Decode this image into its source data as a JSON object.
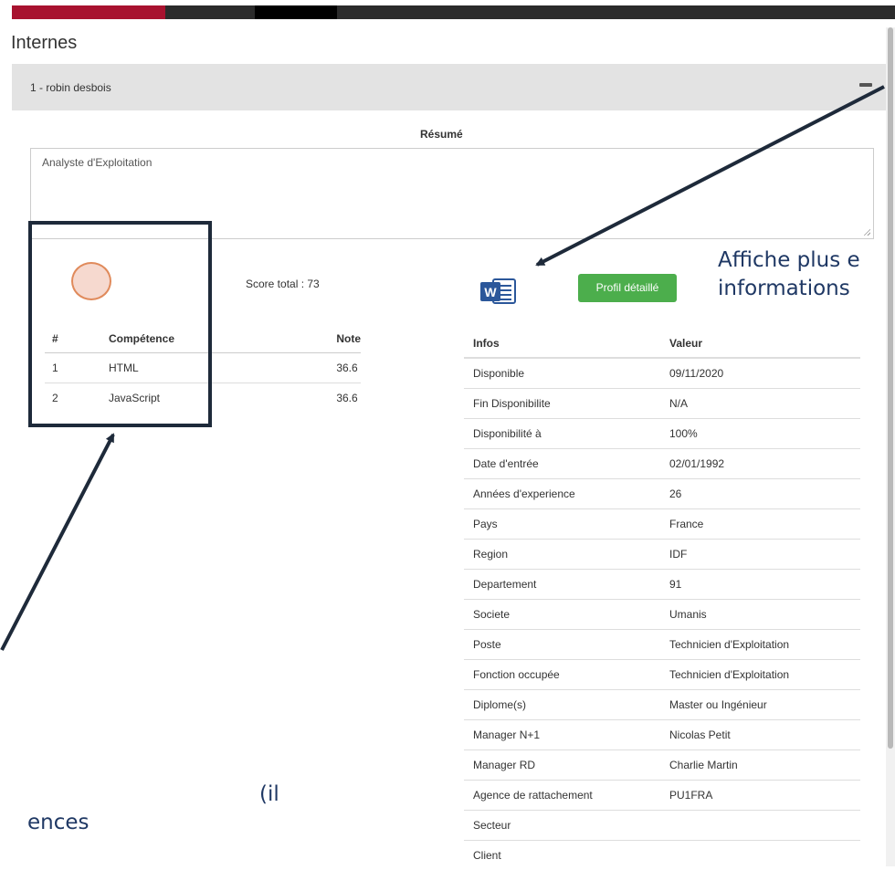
{
  "section": {
    "title": "Internes"
  },
  "panel": {
    "label": "1 - robin desbois"
  },
  "resume": {
    "label": "Résumé",
    "text": "Analyste d'Exploitation"
  },
  "score": {
    "text": "Score total : 73"
  },
  "competences": {
    "headers": [
      "#",
      "Compétence",
      "Note"
    ],
    "rows": [
      [
        "1",
        "HTML",
        "36.6"
      ],
      [
        "2",
        "JavaScript",
        "36.6"
      ]
    ]
  },
  "actions": {
    "profil_button": "Profil détaillé",
    "word_icon_letter": "W"
  },
  "infos": {
    "headers": [
      "Infos",
      "Valeur"
    ],
    "rows": [
      [
        "Disponible",
        "09/11/2020"
      ],
      [
        "Fin Disponibilite",
        "N/A"
      ],
      [
        "Disponibilité à",
        "100%"
      ],
      [
        "Date d'entrée",
        "02/01/1992"
      ],
      [
        "Années d'experience",
        "26"
      ],
      [
        "Pays",
        "France"
      ],
      [
        "Region",
        "IDF"
      ],
      [
        "Departement",
        "91"
      ],
      [
        "Societe",
        "Umanis"
      ],
      [
        "Poste",
        "Technicien d'Exploitation"
      ],
      [
        "Fonction occupée",
        "Technicien d'Exploitation"
      ],
      [
        "Diplome(s)",
        "Master ou Ingénieur"
      ],
      [
        "Manager N+1",
        "Nicolas Petit"
      ],
      [
        "Manager RD",
        "Charlie Martin"
      ],
      [
        "Agence de rattachement",
        "PU1FRA"
      ],
      [
        "Secteur",
        ""
      ],
      [
        "Client",
        ""
      ]
    ]
  },
  "annotations": {
    "right_line1": "Affiche plus e",
    "right_line2": "informations",
    "left_line1": "(il",
    "left_line2": "ences"
  },
  "colors": {
    "brand_red": "#a8122f",
    "button_green": "#4cae4c",
    "annotation_navy": "#1f3864",
    "circle_fill": "#f6d9cf",
    "circle_stroke": "#e08a5b",
    "word_blue": "#2b579a"
  }
}
